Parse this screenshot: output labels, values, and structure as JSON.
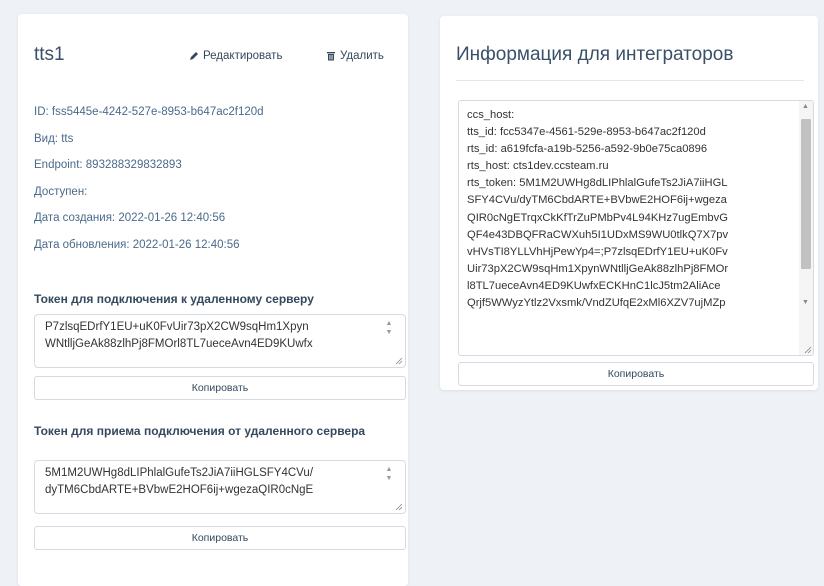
{
  "left": {
    "title": "tts1",
    "edit_label": "Редактировать",
    "delete_label": "Удалить",
    "info": [
      "ID: fss5445e-4242-527e-8953-b647ac2f120d",
      "Вид: tts",
      "Endpoint: 893288329832893",
      "Доступен:",
      "Дата создания: 2022-01-26 12:40:56",
      "Дата обновления: 2022-01-26 12:40:56"
    ],
    "token_remote": {
      "title": "Токен для подключения к удаленному серверу",
      "lines": [
        "P7zlsqEDrfY1EU+uK0FvUir73pX2CW9sqHm1Xpyn",
        "WNtlljGeAk88zlhPj8FMOrl8TL7ueceAvn4ED9KUwfx"
      ],
      "copy_label": "Копировать"
    },
    "token_incoming": {
      "title": "Токен для приема подключения от удаленного сервера",
      "lines": [
        "5M1M2UWHg8dLIPhlalGufeTs2JiA7iiHGLSFY4CVu/",
        "dyTM6CbdARTE+BVbwE2HOF6ij+wgezaQIR0cNgE"
      ],
      "copy_label": "Копировать"
    }
  },
  "right": {
    "title": "Информация для интеграторов",
    "lines": [
      "ccs_host:",
      "tts_id: fcc5347e-4561-529e-8953-b647ac2f120d",
      "rts_id: a619fcfa-a19b-5256-a592-9b0e75ca0896",
      "rts_host: cts1dev.ccsteam.ru",
      "rts_token: 5M1M2UWHg8dLIPhlalGufeTs2JiA7iiHGL",
      "SFY4CVu/dyTM6CbdARTE+BVbwE2HOF6ij+wgeza",
      "QIR0cNgETrqxCkKfTrZuPMbPv4L94KHz7ugEmbvG",
      "QF4e43DBQFRaCWXuh5I1UDxMS9WU0tlkQ7X7pv",
      "vHVsTI8YLLVhHjPewYp4=;P7zlsqEDrfY1EU+uK0Fv",
      "Uir73pX2CW9sqHm1XpynWNtlljGeAk88zlhPj8FMOr",
      "l8TL7ueceAvn4ED9KUwfxECKHnC1lcJ5tm2AliAce",
      "Qrjf5WWyzYtlz2Vxsmk/VndZUfqE2xMl6XZV7ujMZp"
    ],
    "copy_label": "Копировать"
  },
  "icons": {
    "edit": "pencil-icon",
    "delete": "trash-icon"
  }
}
